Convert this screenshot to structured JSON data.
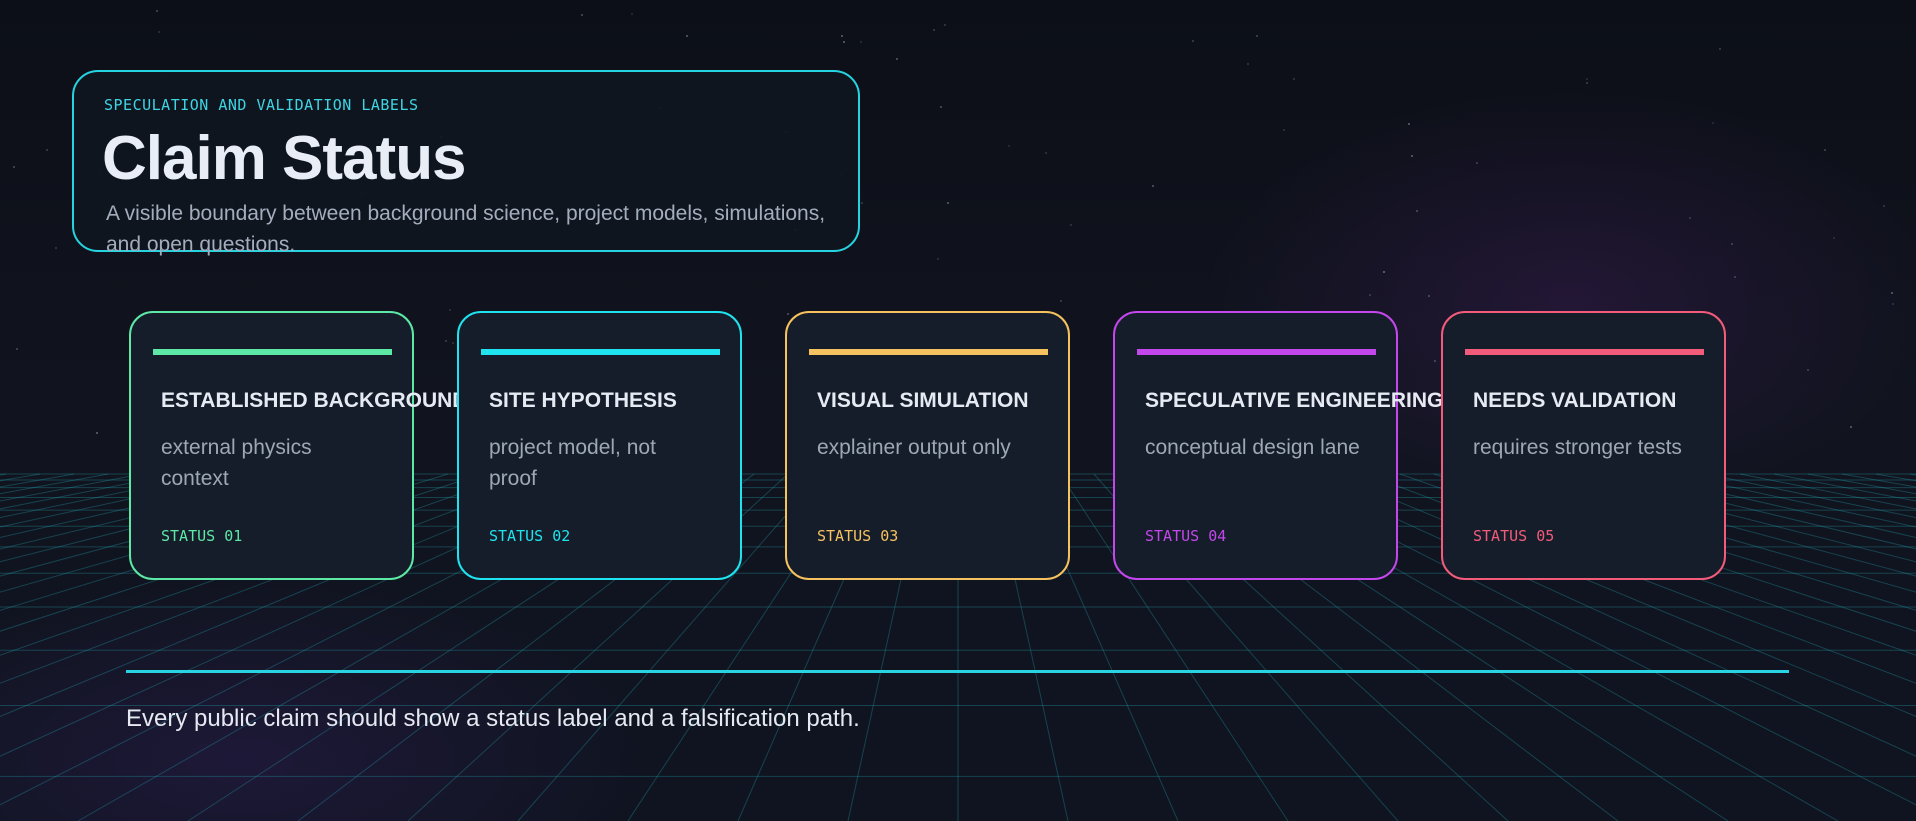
{
  "header": {
    "kicker": "SPECULATION AND VALIDATION LABELS",
    "title": "Claim Status",
    "subtitle": "A visible boundary between background science, project models, simulations, and open questions."
  },
  "cards": [
    {
      "title": "ESTABLISHED BACKGROUND",
      "description": "external physics context",
      "status": "STATUS 01",
      "color": "#5de8a6"
    },
    {
      "title": "SITE HYPOTHESIS",
      "description": "project model, not proof",
      "status": "STATUS 02",
      "color": "#1fe3ef"
    },
    {
      "title": "VISUAL SIMULATION",
      "description": "explainer output only",
      "status": "STATUS 03",
      "color": "#f6c25f"
    },
    {
      "title": "SPECULATIVE ENGINEERING",
      "description": "conceptual design lane",
      "status": "STATUS 04",
      "color": "#c347ec"
    },
    {
      "title": "NEEDS VALIDATION",
      "description": "requires stronger tests",
      "status": "STATUS 05",
      "color": "#f35b7a"
    }
  ],
  "footer": {
    "text": "Every public claim should show a status label and a falsification path."
  },
  "colors": {
    "accent": "#26d3e0",
    "background": "#0d111a",
    "card_background": "#151d2a"
  }
}
